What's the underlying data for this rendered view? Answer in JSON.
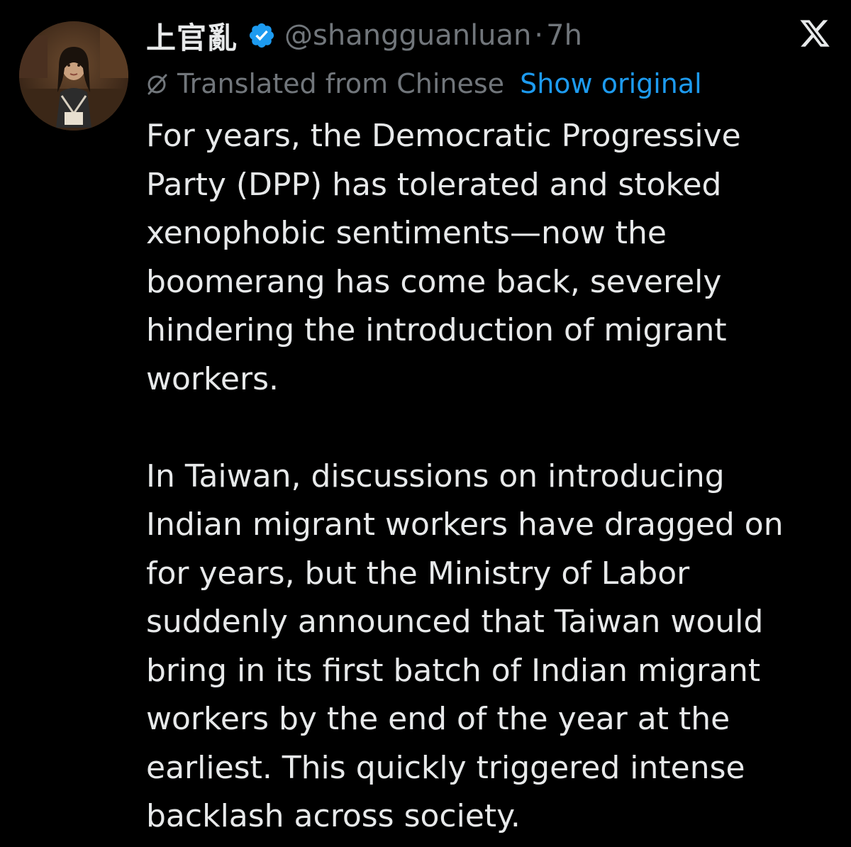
{
  "tweet": {
    "author": {
      "display_name": "上官亂",
      "handle": "@shangguanluan",
      "verified": true,
      "avatar_icon": "avatar-portrait"
    },
    "separator": "·",
    "timestamp": "7h",
    "platform_icon": "x-logo-icon",
    "translation": {
      "notice": "Translated from Chinese",
      "show_original_label": "Show original",
      "icon": "translate-icon"
    },
    "paragraphs": [
      {
        "lines": [
          "For years, the Democratic Progressive",
          "Party (DPP) has tolerated and stoked",
          "xenophobic sentiments—now the",
          "boomerang has come back, severely",
          "hindering the introduction of migrant",
          "workers."
        ]
      },
      {
        "lines": [
          "In Taiwan, discussions on introducing",
          "Indian migrant workers have dragged on",
          "for years, but the Ministry of Labor",
          "suddenly announced that Taiwan would",
          "bring in its first batch of Indian migrant",
          "workers by the end of the year at the",
          "earliest. This quickly triggered intense",
          "backlash across society."
        ]
      }
    ]
  },
  "colors": {
    "background": "#000000",
    "text_primary": "#e7e9ea",
    "text_secondary": "#71767b",
    "link": "#1d9bf0",
    "verified_badge": "#1d9bf0"
  }
}
